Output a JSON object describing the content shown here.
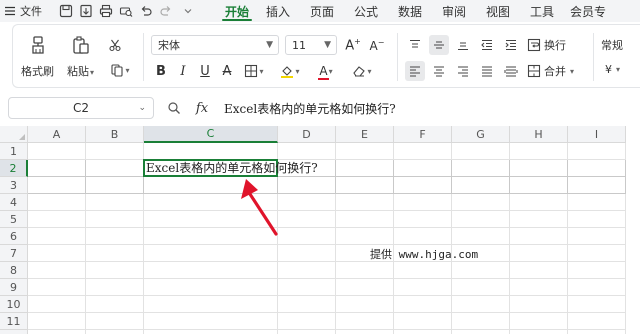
{
  "menubar": {
    "menu_label": "文件",
    "tabs": [
      {
        "label": "开始",
        "active": true
      },
      {
        "label": "插入",
        "active": false
      },
      {
        "label": "页面",
        "active": false
      },
      {
        "label": "公式",
        "active": false
      },
      {
        "label": "数据",
        "active": false
      },
      {
        "label": "审阅",
        "active": false
      },
      {
        "label": "视图",
        "active": false
      },
      {
        "label": "工具",
        "active": false
      },
      {
        "label": "会员专",
        "active": false
      }
    ],
    "quick_access_icons": [
      "menu-icon",
      "save-icon",
      "export-icon",
      "print-icon",
      "print-preview-icon",
      "undo-icon",
      "redo-icon",
      "quick-access-chevron-icon"
    ]
  },
  "ribbon": {
    "format_painter_label": "格式刷",
    "paste_label": "粘贴",
    "font_name": "宋体",
    "font_size": "11",
    "wrap_label": "换行",
    "merge_label": "合并",
    "number_format": "常规",
    "currency_symbol": "¥"
  },
  "formula_bar": {
    "cell_ref": "C2",
    "fx_label": "fx",
    "formula": "Excel表格内的单元格如何换行?"
  },
  "sheet": {
    "columns": [
      "A",
      "B",
      "C",
      "D",
      "E",
      "F",
      "G",
      "H",
      "I"
    ],
    "rows": [
      "1",
      "2",
      "3",
      "4",
      "5",
      "6",
      "7",
      "8",
      "9",
      "10",
      "11",
      "12"
    ],
    "selected_column": "C",
    "selected_row": "2",
    "c2_text": "Excel表格内的单元格如何换行?",
    "watermark": "提供 www.hjga.com"
  },
  "colors": {
    "accent": "#1a7f37",
    "arrow": "#e0142b"
  }
}
